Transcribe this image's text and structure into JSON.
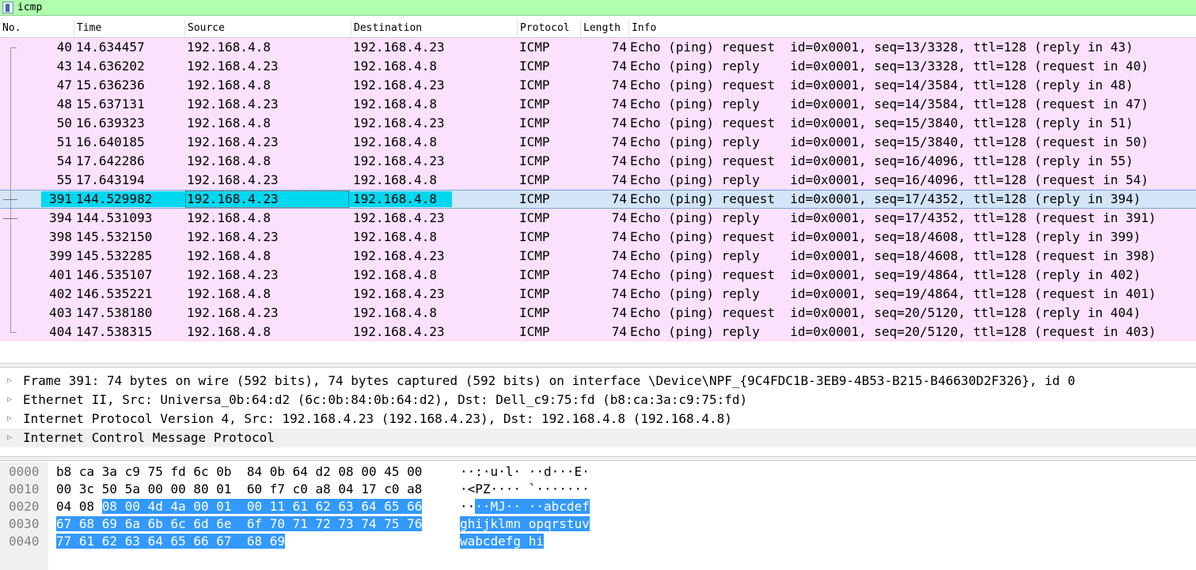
{
  "filter": {
    "text": "icmp"
  },
  "columns": [
    "No.",
    "Time",
    "Source",
    "Destination",
    "Protocol",
    "Length",
    "Info"
  ],
  "packets": [
    {
      "no": "40",
      "time": "14.634457",
      "src": "192.168.4.8",
      "dst": "192.168.4.23",
      "proto": "ICMP",
      "len": "74",
      "info": "Echo (ping) request  id=0x0001, seq=13/3328, ttl=128 (reply in 43)"
    },
    {
      "no": "43",
      "time": "14.636202",
      "src": "192.168.4.23",
      "dst": "192.168.4.8",
      "proto": "ICMP",
      "len": "74",
      "info": "Echo (ping) reply    id=0x0001, seq=13/3328, ttl=128 (request in 40)"
    },
    {
      "no": "47",
      "time": "15.636236",
      "src": "192.168.4.8",
      "dst": "192.168.4.23",
      "proto": "ICMP",
      "len": "74",
      "info": "Echo (ping) request  id=0x0001, seq=14/3584, ttl=128 (reply in 48)"
    },
    {
      "no": "48",
      "time": "15.637131",
      "src": "192.168.4.23",
      "dst": "192.168.4.8",
      "proto": "ICMP",
      "len": "74",
      "info": "Echo (ping) reply    id=0x0001, seq=14/3584, ttl=128 (request in 47)"
    },
    {
      "no": "50",
      "time": "16.639323",
      "src": "192.168.4.8",
      "dst": "192.168.4.23",
      "proto": "ICMP",
      "len": "74",
      "info": "Echo (ping) request  id=0x0001, seq=15/3840, ttl=128 (reply in 51)"
    },
    {
      "no": "51",
      "time": "16.640185",
      "src": "192.168.4.23",
      "dst": "192.168.4.8",
      "proto": "ICMP",
      "len": "74",
      "info": "Echo (ping) reply    id=0x0001, seq=15/3840, ttl=128 (request in 50)"
    },
    {
      "no": "54",
      "time": "17.642286",
      "src": "192.168.4.8",
      "dst": "192.168.4.23",
      "proto": "ICMP",
      "len": "74",
      "info": "Echo (ping) request  id=0x0001, seq=16/4096, ttl=128 (reply in 55)"
    },
    {
      "no": "55",
      "time": "17.643194",
      "src": "192.168.4.23",
      "dst": "192.168.4.8",
      "proto": "ICMP",
      "len": "74",
      "info": "Echo (ping) reply    id=0x0001, seq=16/4096, ttl=128 (request in 54)"
    },
    {
      "no": "391",
      "time": "144.529982",
      "src": "192.168.4.23",
      "dst": "192.168.4.8",
      "proto": "ICMP",
      "len": "74",
      "info": "Echo (ping) request  id=0x0001, seq=17/4352, ttl=128 (reply in 394)"
    },
    {
      "no": "394",
      "time": "144.531093",
      "src": "192.168.4.8",
      "dst": "192.168.4.23",
      "proto": "ICMP",
      "len": "74",
      "info": "Echo (ping) reply    id=0x0001, seq=17/4352, ttl=128 (request in 391)"
    },
    {
      "no": "398",
      "time": "145.532150",
      "src": "192.168.4.23",
      "dst": "192.168.4.8",
      "proto": "ICMP",
      "len": "74",
      "info": "Echo (ping) request  id=0x0001, seq=18/4608, ttl=128 (reply in 399)"
    },
    {
      "no": "399",
      "time": "145.532285",
      "src": "192.168.4.8",
      "dst": "192.168.4.23",
      "proto": "ICMP",
      "len": "74",
      "info": "Echo (ping) reply    id=0x0001, seq=18/4608, ttl=128 (request in 398)"
    },
    {
      "no": "401",
      "time": "146.535107",
      "src": "192.168.4.23",
      "dst": "192.168.4.8",
      "proto": "ICMP",
      "len": "74",
      "info": "Echo (ping) request  id=0x0001, seq=19/4864, ttl=128 (reply in 402)"
    },
    {
      "no": "402",
      "time": "146.535221",
      "src": "192.168.4.8",
      "dst": "192.168.4.23",
      "proto": "ICMP",
      "len": "74",
      "info": "Echo (ping) reply    id=0x0001, seq=19/4864, ttl=128 (request in 401)"
    },
    {
      "no": "403",
      "time": "147.538180",
      "src": "192.168.4.23",
      "dst": "192.168.4.8",
      "proto": "ICMP",
      "len": "74",
      "info": "Echo (ping) request  id=0x0001, seq=20/5120, ttl=128 (reply in 404)"
    },
    {
      "no": "404",
      "time": "147.538315",
      "src": "192.168.4.8",
      "dst": "192.168.4.23",
      "proto": "ICMP",
      "len": "74",
      "info": "Echo (ping) reply    id=0x0001, seq=20/5120, ttl=128 (request in 403)"
    }
  ],
  "selected_row": 8,
  "details": [
    "Frame 391: 74 bytes on wire (592 bits), 74 bytes captured (592 bits) on interface \\Device\\NPF_{9C4FDC1B-3EB9-4B53-B215-B46630D2F326}, id 0",
    "Ethernet II, Src: Universa_0b:64:d2 (6c:0b:84:0b:64:d2), Dst: Dell_c9:75:fd (b8:ca:3a:c9:75:fd)",
    "Internet Protocol Version 4, Src: 192.168.4.23 (192.168.4.23), Dst: 192.168.4.8 (192.168.4.8)",
    "Internet Control Message Protocol"
  ],
  "bytes": [
    {
      "off": "0000",
      "hex_plain": "b8 ca 3a c9 75 fd 6c 0b  84 0b 64 d2 08 00 45 00",
      "hex_hl": "",
      "asc_plain": "··:·u·l· ··d···E·",
      "asc_hl": ""
    },
    {
      "off": "0010",
      "hex_plain": "00 3c 50 5a 00 00 80 01  60 f7 c0 a8 04 17 c0 a8",
      "hex_hl": "",
      "asc_plain": "·<PZ···· `·······",
      "asc_hl": ""
    },
    {
      "off": "0020",
      "hex_plain": "04 08 ",
      "hex_hl": "08 00 4d 4a 00 01  00 11 61 62 63 64 65 66",
      "asc_plain": "··",
      "asc_hl": "··MJ·· ··abcdef"
    },
    {
      "off": "0030",
      "hex_plain": "",
      "hex_hl": "67 68 69 6a 6b 6c 6d 6e  6f 70 71 72 73 74 75 76",
      "asc_plain": "",
      "asc_hl": "ghijklmn opqrstuv"
    },
    {
      "off": "0040",
      "hex_plain": "",
      "hex_hl": "77 61 62 63 64 65 66 67  68 69",
      "asc_plain": "",
      "asc_hl": "wabcdefg hi"
    }
  ]
}
